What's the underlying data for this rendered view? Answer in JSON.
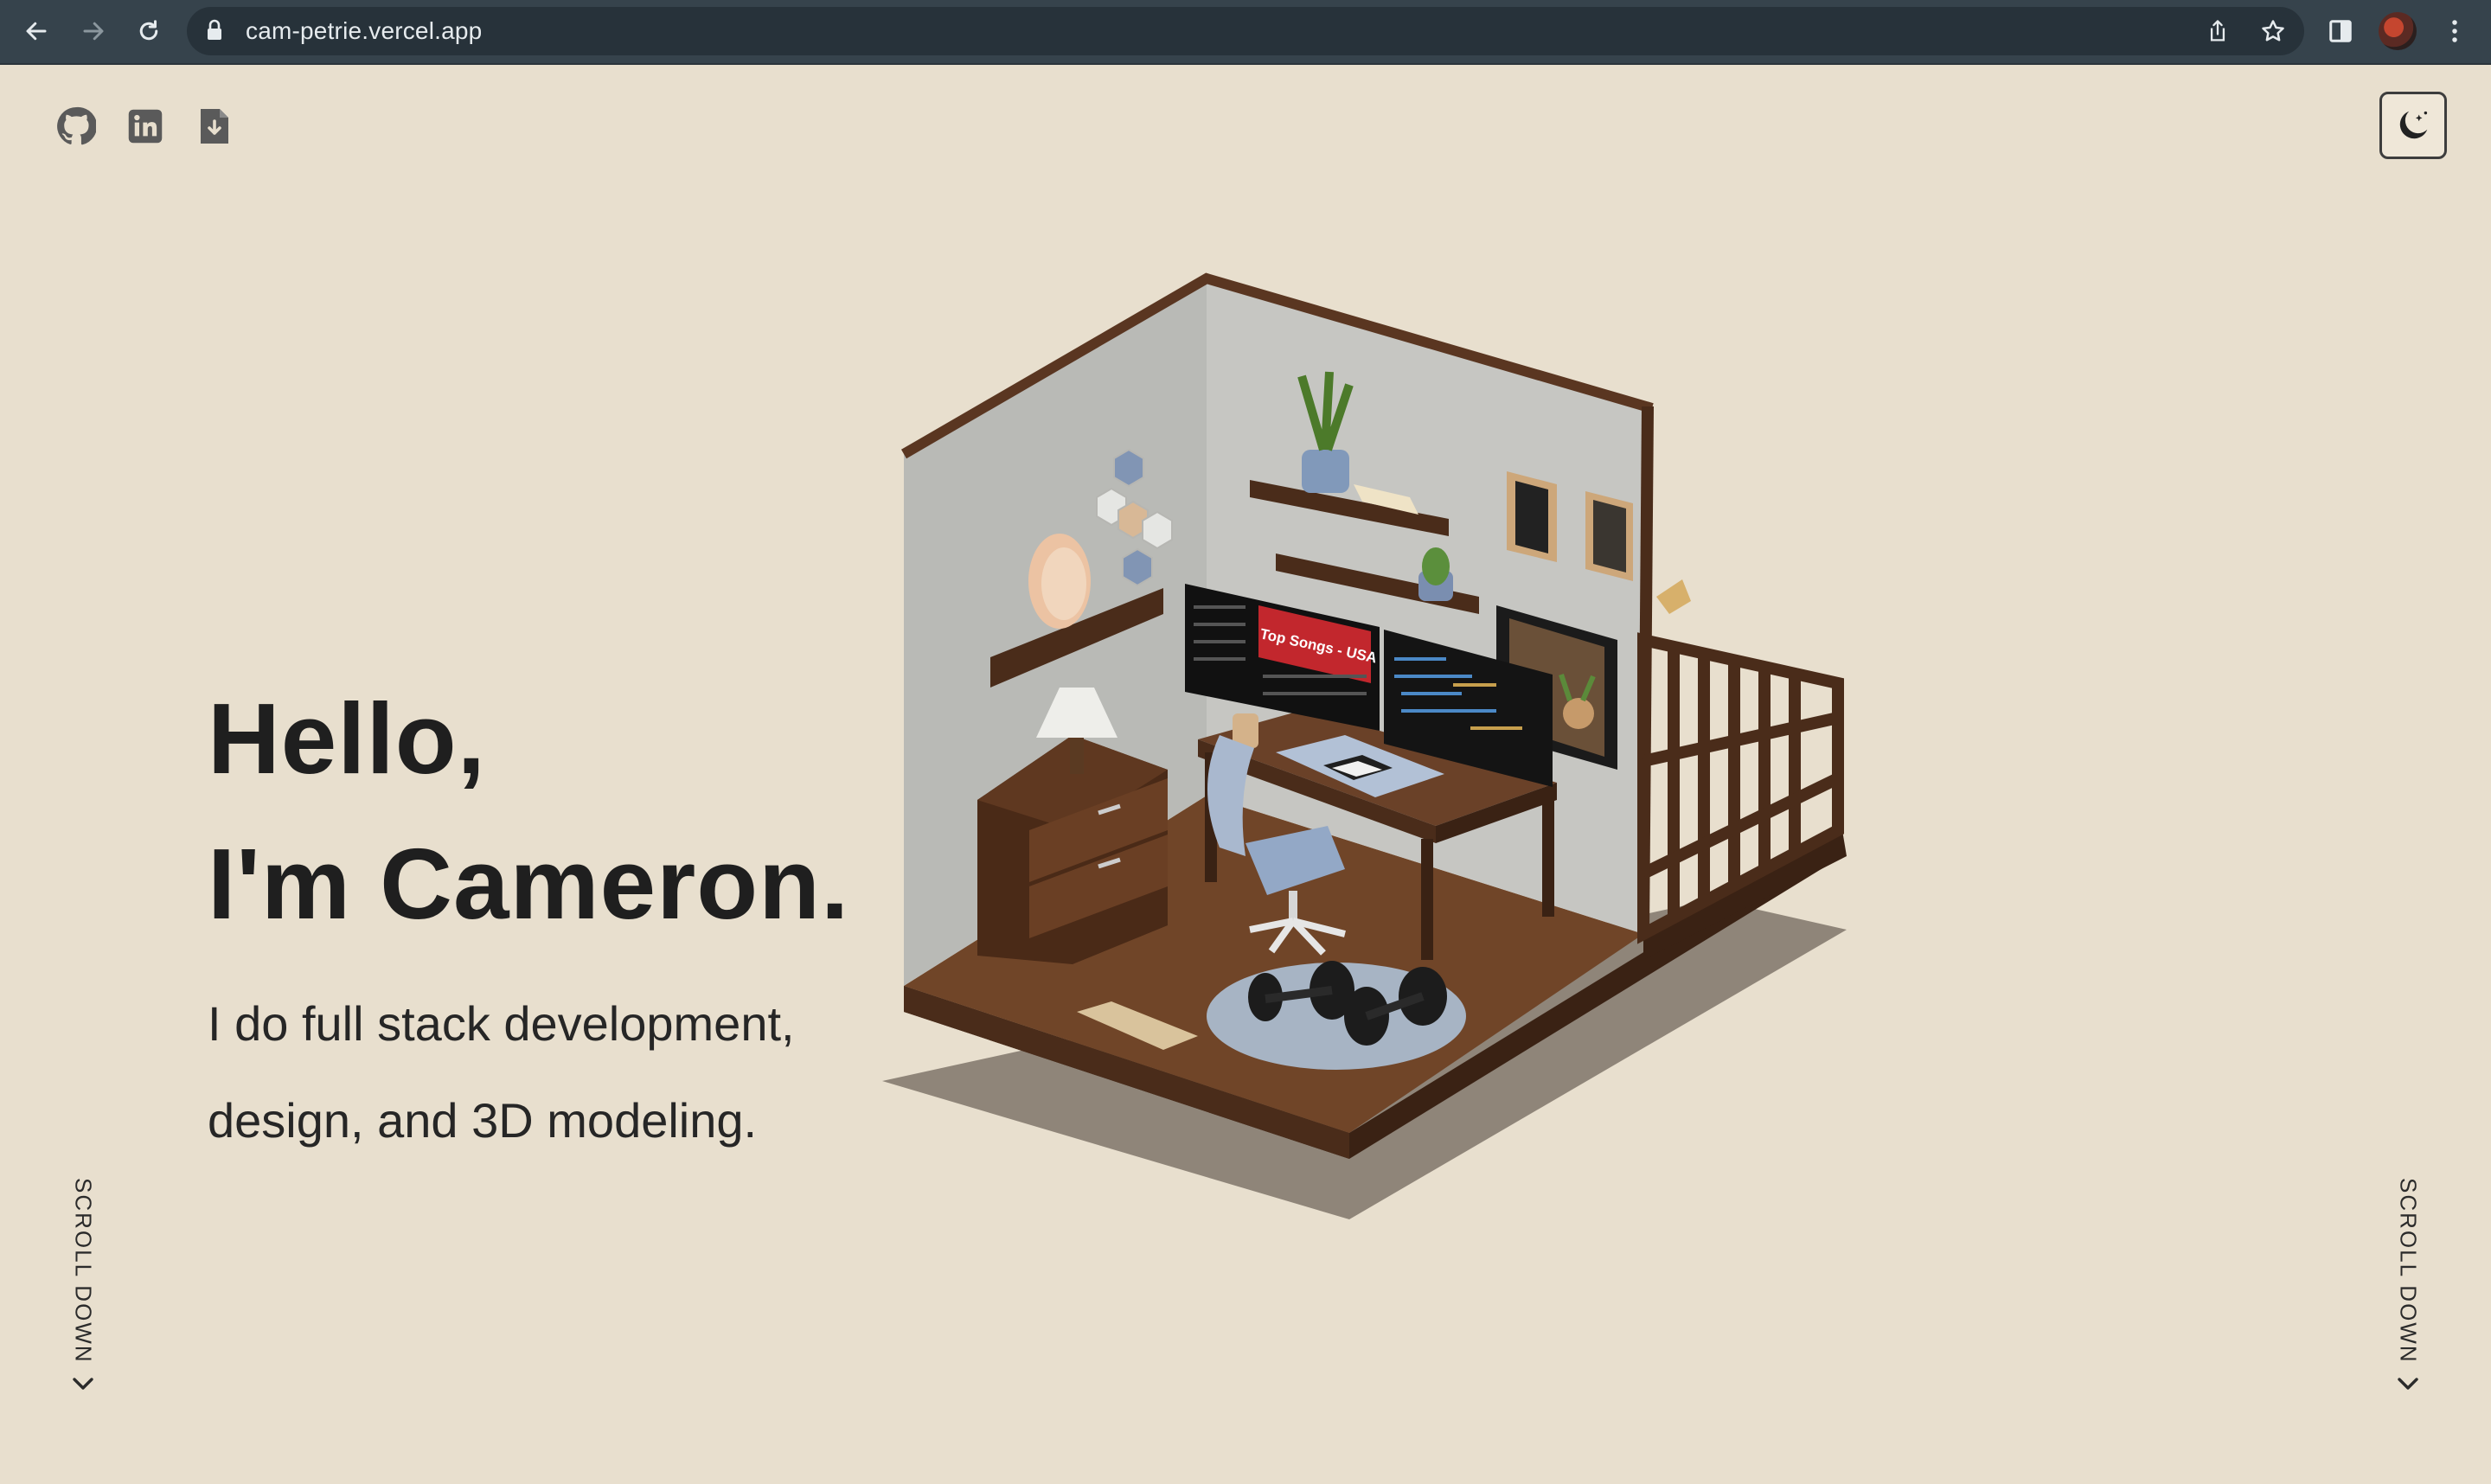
{
  "browser": {
    "url": "cam-petrie.vercel.app"
  },
  "social": {
    "github_icon": "github-icon",
    "linkedin_icon": "linkedin-icon",
    "resume_icon": "resume-download-icon"
  },
  "theme_toggle": {
    "icon": "moon-icon"
  },
  "hero": {
    "line1": "Hello,",
    "line2": "I'm Cameron.",
    "sub1": "I do full stack development,",
    "sub2": "design, and 3D modeling."
  },
  "scroll": {
    "left_label": "SCROLL DOWN",
    "right_label": "SCROLL DOWN"
  },
  "room": {
    "monitor_heading": "Top Songs - USA"
  },
  "colors": {
    "background": "#e8dfce",
    "text": "#1f1f1f",
    "chrome": "#36434c",
    "wood": "#5a3621"
  }
}
